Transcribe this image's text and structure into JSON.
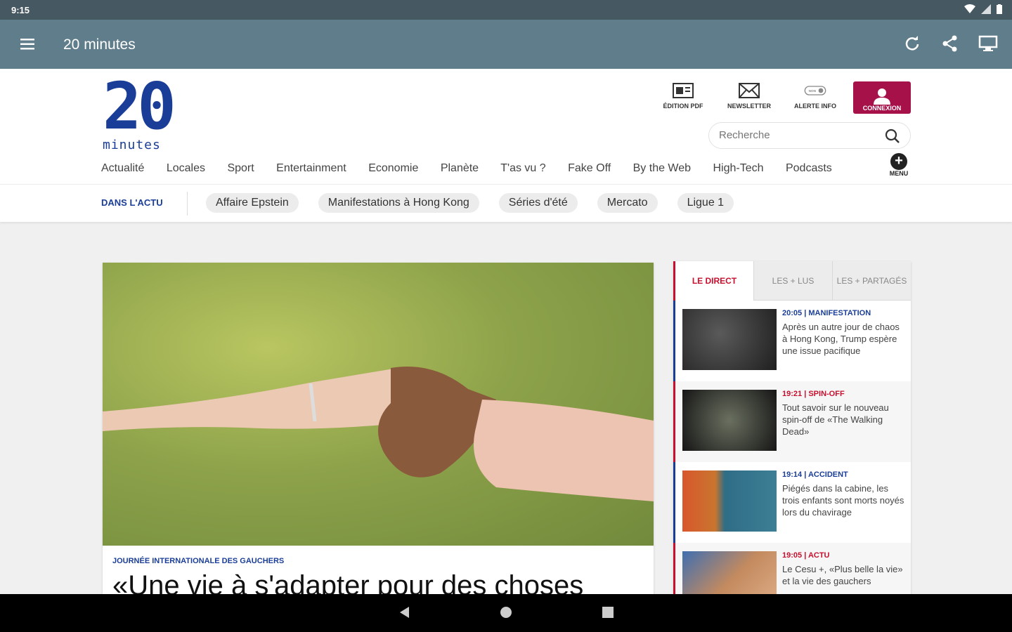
{
  "status_bar": {
    "time": "9:15"
  },
  "app_bar": {
    "title": "20 minutes",
    "actions": [
      "refresh-icon",
      "share-icon",
      "desktop-icon"
    ]
  },
  "logo": {
    "number": "20",
    "word": "minutes"
  },
  "tools": [
    {
      "label": "ÉDITION PDF",
      "icon": "pdf-icon"
    },
    {
      "label": "NEWSLETTER",
      "icon": "envelope-icon"
    },
    {
      "label": "ALERTE INFO",
      "icon": "toggle-icon",
      "toggle_text": "NON"
    },
    {
      "label": "CONNEXION",
      "icon": "user-icon"
    }
  ],
  "search": {
    "placeholder": "Recherche"
  },
  "nav": [
    "Actualité",
    "Locales",
    "Sport",
    "Entertainment",
    "Economie",
    "Planète",
    "T'as vu ?",
    "Fake Off",
    "By the Web",
    "High-Tech",
    "Podcasts"
  ],
  "menu_label": "MENU",
  "trending": {
    "label": "DANS L'ACTU",
    "items": [
      "Affaire Epstein",
      "Manifestations à Hong Kong",
      "Séries d'été",
      "Mercato",
      "Ligue 1"
    ]
  },
  "hero": {
    "kicker": "JOURNÉE INTERNATIONALE DES GAUCHERS",
    "headline": "«Une vie à s'adapter pour des choses"
  },
  "sidebar": {
    "tabs": [
      "LE DIRECT",
      "LES + LUS",
      "LES + PARTAGÉS"
    ],
    "items": [
      {
        "time": "20:05",
        "category": "MANIFESTATION",
        "text": "Après un autre jour de chaos à Hong Kong, Trump espère une issue pacifique"
      },
      {
        "time": "19:21",
        "category": "SPIN-OFF",
        "text": "Tout savoir sur le nouveau spin-off de «The Walking Dead»"
      },
      {
        "time": "19:14",
        "category": "ACCIDENT",
        "text": "Piégés dans la cabine, les trois enfants sont morts noyés lors du chavirage"
      },
      {
        "time": "19:05",
        "category": "ACTU",
        "text": "Le Cesu +, «Plus belle la vie» et la vie des gauchers"
      }
    ]
  },
  "colors": {
    "appbar": "#607d8b",
    "brand_blue": "#1a3e97",
    "connexion": "#a6114a",
    "live_red": "#c8102e"
  }
}
